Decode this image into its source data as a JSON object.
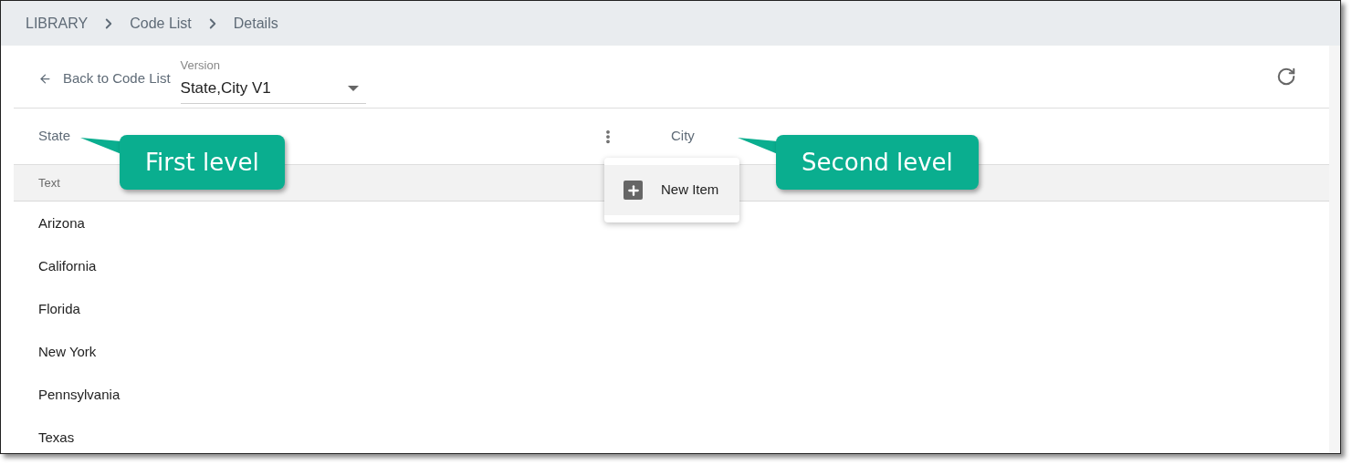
{
  "breadcrumb": [
    "LIBRARY",
    "Code List",
    "Details"
  ],
  "back_link": "Back to Code List",
  "version_field": {
    "label": "Version",
    "value": "State,City V1"
  },
  "levels": [
    {
      "label": "State"
    },
    {
      "label": "City"
    }
  ],
  "menu": {
    "items": [
      {
        "label": "New Item",
        "selected": true
      }
    ]
  },
  "table": {
    "columns": [
      "Text"
    ],
    "rows": [
      "Arizona",
      "California",
      "Florida",
      "New York",
      "Pennsylvania",
      "Texas"
    ]
  },
  "callouts": [
    {
      "text": "First level"
    },
    {
      "text": "Second level"
    }
  ]
}
